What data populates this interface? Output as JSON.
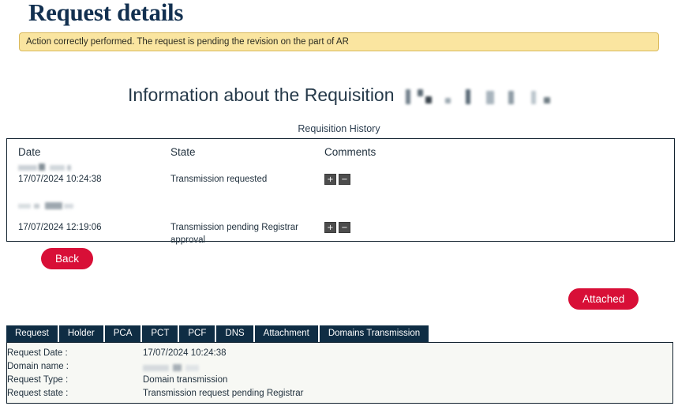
{
  "page": {
    "title": "Request details"
  },
  "alert": {
    "message": "Action correctly performed. The request is pending the revision on the part of AR",
    "bg_color": "#fae5a0",
    "border_color": "#d9b95c"
  },
  "requisition": {
    "heading": "Information about the Requisition",
    "number_redacted": true,
    "history_caption": "Requisition History"
  },
  "history_table": {
    "columns": [
      "Date",
      "State",
      "Comments"
    ],
    "rows": [
      {
        "date": "17/07/2024 10:24:38",
        "date_redacted_above": true,
        "state": "Transmission requested",
        "comment_expand_label": "+",
        "comment_collapse_label": "−"
      },
      {
        "date": "17/07/2024 12:19:06",
        "date_redacted_above": true,
        "state": "Transmission pending Registrar approval",
        "comment_expand_label": "+",
        "comment_collapse_label": "−"
      }
    ]
  },
  "buttons": {
    "back_label": "Back",
    "attached_label": "Attached",
    "pill_color": "#d80f37"
  },
  "tabs": {
    "items": [
      {
        "label": "Request",
        "active": true
      },
      {
        "label": "Holder",
        "active": false
      },
      {
        "label": "PCA",
        "active": false
      },
      {
        "label": "PCT",
        "active": false
      },
      {
        "label": "PCF",
        "active": false
      },
      {
        "label": "DNS",
        "active": false
      },
      {
        "label": "Attachment",
        "active": false
      },
      {
        "label": "Domains Transmission",
        "active": false
      }
    ],
    "tab_color": "#0f2d44"
  },
  "detail_panel": {
    "rows": [
      {
        "label": "Request Date :",
        "value": "17/07/2024 10:24:38",
        "redacted": false
      },
      {
        "label": "Domain name :",
        "value": "",
        "redacted": true
      },
      {
        "label": "Request Type :",
        "value": "Domain transmission",
        "redacted": false
      },
      {
        "label": "Request state :",
        "value": "Transmission request pending Registrar",
        "redacted": false
      }
    ]
  }
}
